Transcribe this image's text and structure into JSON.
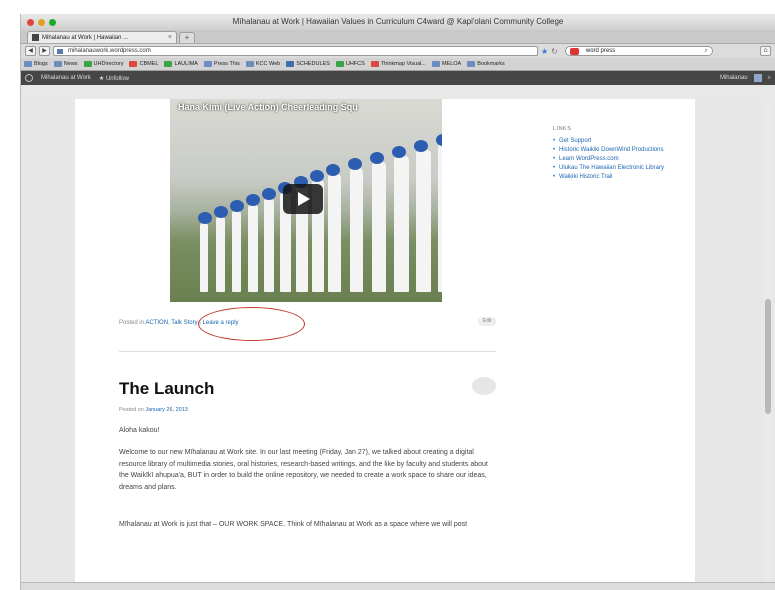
{
  "window": {
    "title": "Mīhalanau at Work | Hawaiian Values in Curriculum C4ward @ Kapi'olani Community College"
  },
  "tabs": [
    {
      "label": "Mihalanau at Work | Hawaiian ..."
    }
  ],
  "nav": {
    "url": "mihalanauwork.wordpress.com",
    "search_value": "word press"
  },
  "bookmarks": [
    "Blogs",
    "News",
    "UHDirectory",
    "CBMEL",
    "LAULIMA",
    "Press This",
    "KCC Web",
    "SCHEDULES",
    "UHFCS",
    "Thinkmap Visual...",
    "MELOA",
    "Bookmarks"
  ],
  "admin_bar": {
    "site": "Mihalanau at Work",
    "unfollow": "Unfollow",
    "user": "Mihalanau"
  },
  "video": {
    "title": "Hana Kimi (Live Action) Cheerleading Squ"
  },
  "post_meta": {
    "prefix": "Posted in",
    "category": "ACTION",
    "sep1": ",",
    "tag": "Talk Story",
    "sep2": "|",
    "reply": "Leave a reply",
    "edit": "Edit"
  },
  "post": {
    "title": "The Launch",
    "posted_prefix": "Posted on",
    "date": "January 26, 2013",
    "p1": "Aloha kakou!",
    "p2": "Welcome to our new Mīhalanau at Work site. In our last meeting (Friday, Jan 27), we talked about creating a digital resource library of multimedia stories, oral histories, research-based writings, and the like by faculty and students about the Waikīkī ahupua'a, BUT in order to build the online repository, we needed to create a work space to share our ideas, dreams and plans.",
    "p3": "Mīhalanau at Work is just that – OUR WORK SPACE. Think of Mīhalanau at Work as a space where we will post"
  },
  "sidebar": {
    "heading": "LINKS",
    "links": [
      "Get Support",
      "Historic Waikiki DownWind Productions",
      "Learn WordPress.com",
      "Ulukau The Hawaiian Electronic Library",
      "Waikiki Historic Trail"
    ]
  }
}
